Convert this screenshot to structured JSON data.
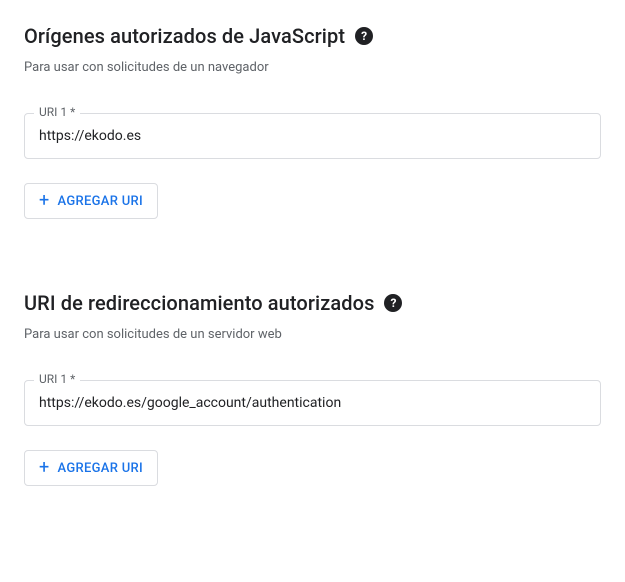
{
  "sections": {
    "js_origins": {
      "title": "Orígenes autorizados de JavaScript",
      "description": "Para usar con solicitudes de un navegador",
      "input_label": "URI 1 *",
      "input_value": "https://ekodo.es",
      "add_button": "AGREGAR URI"
    },
    "redirect_uris": {
      "title": "URI de redireccionamiento autorizados",
      "description": "Para usar con solicitudes de un servidor web",
      "input_label": "URI 1 *",
      "input_value": "https://ekodo.es/google_account/authentication",
      "add_button": "AGREGAR URI"
    }
  },
  "icons": {
    "help": "?",
    "plus": "+"
  }
}
